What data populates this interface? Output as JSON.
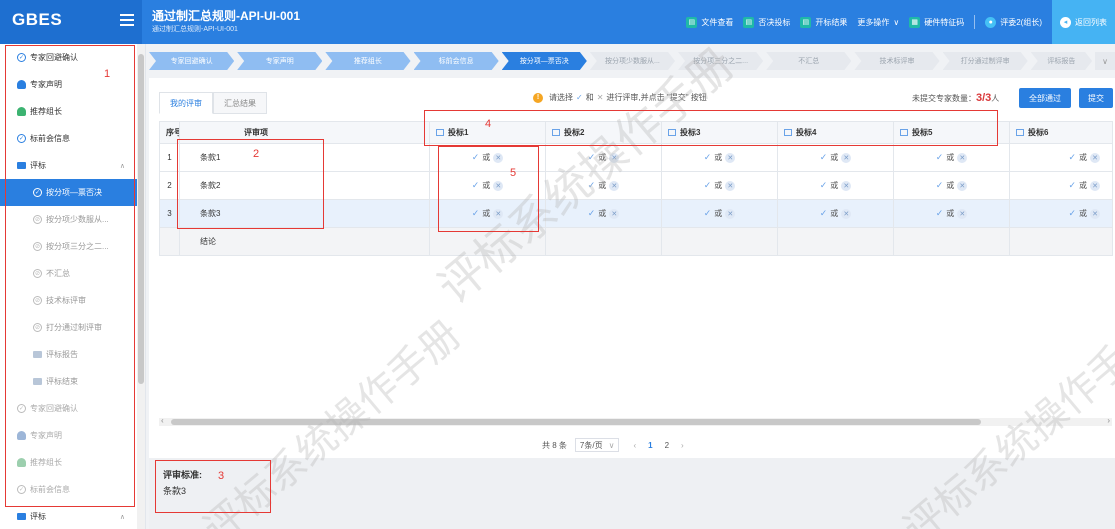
{
  "app": {
    "brand": "GBES",
    "title": "通过制汇总规则-API-UI-001",
    "subtitle": "通过制汇总规则-API-UI-001"
  },
  "toolbar": {
    "items": [
      "文件查看",
      "否决投标",
      "开标结果",
      "更多操作",
      "硬件特征码",
      "评委2(组长)",
      "返回列表"
    ]
  },
  "sidebar": {
    "items": [
      {
        "label": "专家回避确认",
        "icon": "check-circle-icon"
      },
      {
        "label": "专家声明",
        "icon": "person-icon"
      },
      {
        "label": "推荐组长",
        "icon": "person-icon"
      },
      {
        "label": "标前会信息",
        "icon": "check-circle-icon"
      },
      {
        "label": "评标",
        "icon": "folder-icon"
      },
      {
        "label": "按分项—票否决",
        "icon": "check-circle-icon"
      },
      {
        "label": "按分项少数服从...",
        "icon": "check-circle-icon"
      },
      {
        "label": "按分项三分之二...",
        "icon": "check-circle-icon"
      },
      {
        "label": "不汇总",
        "icon": "check-circle-icon"
      },
      {
        "label": "技术标评审",
        "icon": "check-circle-icon"
      },
      {
        "label": "打分通过制评审",
        "icon": "check-circle-icon"
      },
      {
        "label": "评标报告",
        "icon": "folder-icon"
      },
      {
        "label": "评标结束",
        "icon": "folder-icon"
      },
      {
        "label": "专家回避确认",
        "icon": "check-circle-icon"
      },
      {
        "label": "专家声明",
        "icon": "person-icon"
      },
      {
        "label": "推荐组长",
        "icon": "person-icon"
      },
      {
        "label": "标前会信息",
        "icon": "check-circle-icon"
      },
      {
        "label": "评标",
        "icon": "folder-icon"
      }
    ]
  },
  "steps": [
    "专家回避确认",
    "专家声明",
    "推荐组长",
    "标前会信息",
    "按分项—票否决",
    "按分项少数服从...",
    "按分项三分之二...",
    "不汇总",
    "技术标评审",
    "打分通过制评审",
    "评标报告"
  ],
  "tabs": [
    "我的评审",
    "汇总结果"
  ],
  "notice": {
    "pre": "请选择",
    "and": "和",
    "post": "进行评审,并点击 \"提交\" 按钮"
  },
  "count": {
    "label": "未提交专家数量：",
    "value": "3/3",
    "unit": "人"
  },
  "buttons": {
    "pass_all": "全部通过",
    "submit": "提交"
  },
  "table": {
    "col_no": "序号",
    "col_item": "评审项",
    "bids": [
      "投标1",
      "投标2",
      "投标3",
      "投标4",
      "投标5",
      "投标6"
    ],
    "rows": [
      {
        "no": "1",
        "item": "条款1"
      },
      {
        "no": "2",
        "item": "条款2"
      },
      {
        "no": "3",
        "item": "条款3"
      }
    ],
    "footer": "结论",
    "or_text": "或"
  },
  "pager": {
    "total": "共 8 条",
    "size": "7条/页",
    "pages": [
      "1",
      "2"
    ]
  },
  "criteria": {
    "label": "评审标准:",
    "value": "条款3"
  },
  "annotations": [
    "1",
    "2",
    "3",
    "4",
    "5"
  ],
  "watermark": "评标系统操作手册"
}
